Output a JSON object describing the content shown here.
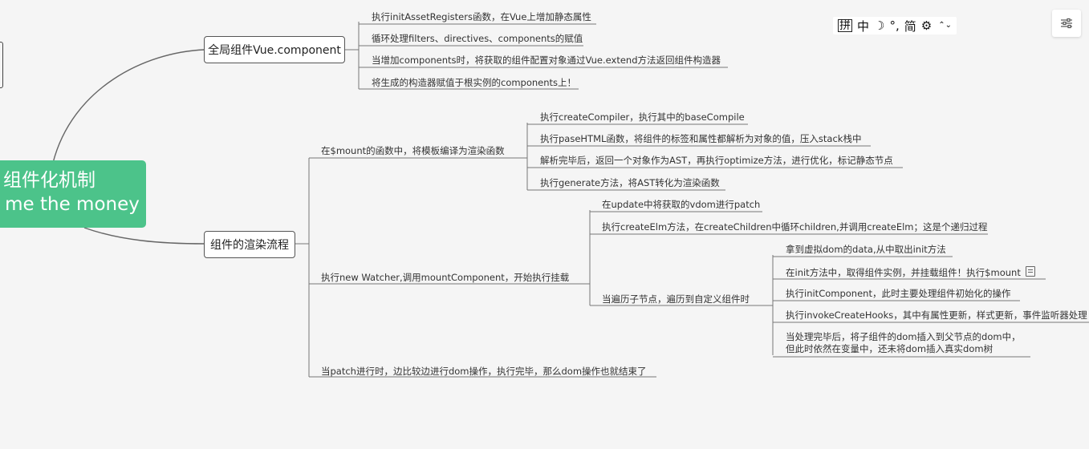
{
  "root": {
    "line1": "组件化机制",
    "line2": "w me the money"
  },
  "branch1": {
    "label": "全局组件Vue.component",
    "items": [
      "执行initAssetRegisters函数，在Vue上增加静态属性",
      "循环处理filters、directives、components的赋值",
      "当增加components时，将获取的组件配置对象通过Vue.extend方法返回组件构造器",
      "将生成的构造器赋值于根实例的components上！"
    ]
  },
  "branch2": {
    "label": "组件的渲染流程",
    "mount": {
      "label": "在$mount的函数中，将模板编译为渲染函数",
      "items": [
        "执行createCompiler，执行其中的baseCompile",
        "执行paseHTML函数，将组件的标签和属性都解析为对象的值，压入stack栈中",
        "解析完毕后，返回一个对象作为AST，再执行optimize方法，进行优化，标记静态节点",
        "执行generate方法，将AST转化为渲染函数"
      ]
    },
    "watcher": {
      "label": "执行new Watcher,调用mountComponent，开始执行挂载",
      "items": [
        "在update中将获取的vdom进行patch",
        "执行createElm方法，在createChildren中循环children,并调用createElm；这是个递归过程"
      ],
      "traverse": {
        "label": "当遍历子节点，遍历到自定义组件时",
        "items": [
          "拿到虚拟dom的data,从中取出init方法",
          "在init方法中，取得组件实例，并挂载组件！执行$mount",
          "执行initComponent，此时主要处理组件初始化的操作",
          "执行invokeCreateHooks，其中有属性更新，样式更新，事件监听器处理",
          "当处理完毕后，将子组件的dom插入到父节点的dom中，但此时依然在变量中，还未将dom插入真实dom树"
        ]
      }
    },
    "patch": {
      "label": "当patch进行时，边比较边进行dom操作，执行完毕，那么dom操作也就结束了"
    }
  },
  "toolbar": {
    "keyboard": "拼",
    "mode": "中",
    "moon": "☽",
    "punct": "°,",
    "simplified": "简",
    "gear": "⚙",
    "chevron": "⌃⌄"
  },
  "colors": {
    "root": "#4cc38a",
    "line": "#666666"
  }
}
